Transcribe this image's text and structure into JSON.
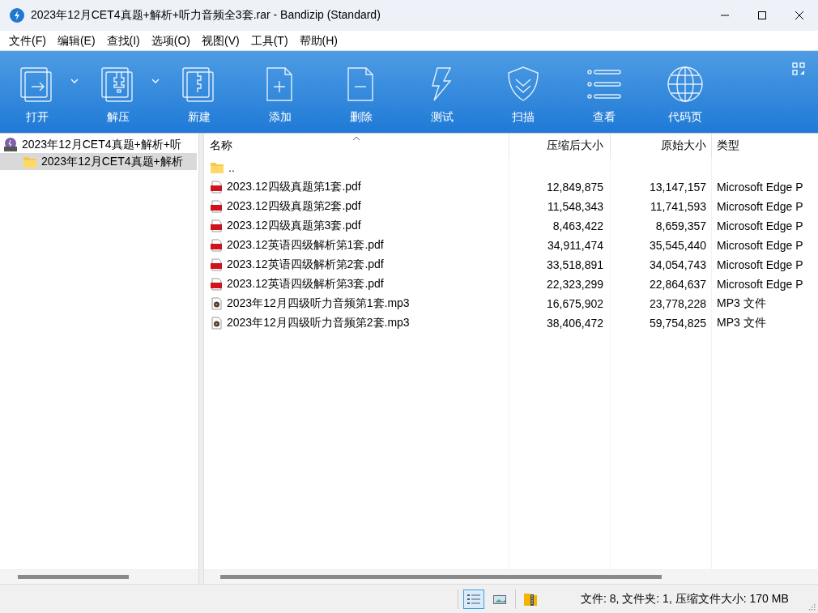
{
  "window": {
    "title": "2023年12月CET4真题+解析+听力音频全3套.rar - Bandizip (Standard)"
  },
  "menu": [
    "文件(F)",
    "编辑(E)",
    "查找(I)",
    "选项(O)",
    "视图(V)",
    "工具(T)",
    "帮助(H)"
  ],
  "toolbar": [
    {
      "label": "打开",
      "dropdown": true
    },
    {
      "label": "解压",
      "dropdown": true
    },
    {
      "label": "新建",
      "dropdown": false
    },
    {
      "label": "添加",
      "dropdown": false
    },
    {
      "label": "删除",
      "dropdown": false
    },
    {
      "label": "测试",
      "dropdown": false
    },
    {
      "label": "扫描",
      "dropdown": false
    },
    {
      "label": "查看",
      "dropdown": false
    },
    {
      "label": "代码页",
      "dropdown": false
    }
  ],
  "tree": [
    {
      "label": "2023年12月CET4真题+解析+听",
      "kind": "archive",
      "selected": false,
      "children": [
        {
          "label": "2023年12月CET4真题+解析",
          "kind": "folder",
          "selected": true
        }
      ]
    }
  ],
  "table": {
    "columns": [
      "名称",
      "压缩后大小",
      "原始大小",
      "类型"
    ],
    "rows": [
      {
        "kind": "folder",
        "name": "..",
        "packed": "",
        "original": "",
        "type": ""
      },
      {
        "kind": "pdf",
        "name": "2023.12四级真题第1套.pdf",
        "packed": "12,849,875",
        "original": "13,147,157",
        "type": "Microsoft Edge P"
      },
      {
        "kind": "pdf",
        "name": "2023.12四级真题第2套.pdf",
        "packed": "11,548,343",
        "original": "11,741,593",
        "type": "Microsoft Edge P"
      },
      {
        "kind": "pdf",
        "name": "2023.12四级真题第3套.pdf",
        "packed": "8,463,422",
        "original": "8,659,357",
        "type": "Microsoft Edge P"
      },
      {
        "kind": "pdf",
        "name": "2023.12英语四级解析第1套.pdf",
        "packed": "34,911,474",
        "original": "35,545,440",
        "type": "Microsoft Edge P"
      },
      {
        "kind": "pdf",
        "name": "2023.12英语四级解析第2套.pdf",
        "packed": "33,518,891",
        "original": "34,054,743",
        "type": "Microsoft Edge P"
      },
      {
        "kind": "pdf",
        "name": "2023.12英语四级解析第3套.pdf",
        "packed": "22,323,299",
        "original": "22,864,637",
        "type": "Microsoft Edge P"
      },
      {
        "kind": "mp3",
        "name": "2023年12月四级听力音频第1套.mp3",
        "packed": "16,675,902",
        "original": "23,778,228",
        "type": "MP3 文件"
      },
      {
        "kind": "mp3",
        "name": "2023年12月四级听力音频第2套.mp3",
        "packed": "38,406,472",
        "original": "59,754,825",
        "type": "MP3 文件"
      }
    ]
  },
  "status_bar": {
    "views": [
      {
        "kind": "details",
        "selected": true
      },
      {
        "kind": "thumbnails",
        "selected": false
      }
    ],
    "text": "文件: 8, 文件夹: 1, 压缩文件大小: 170 MB"
  }
}
